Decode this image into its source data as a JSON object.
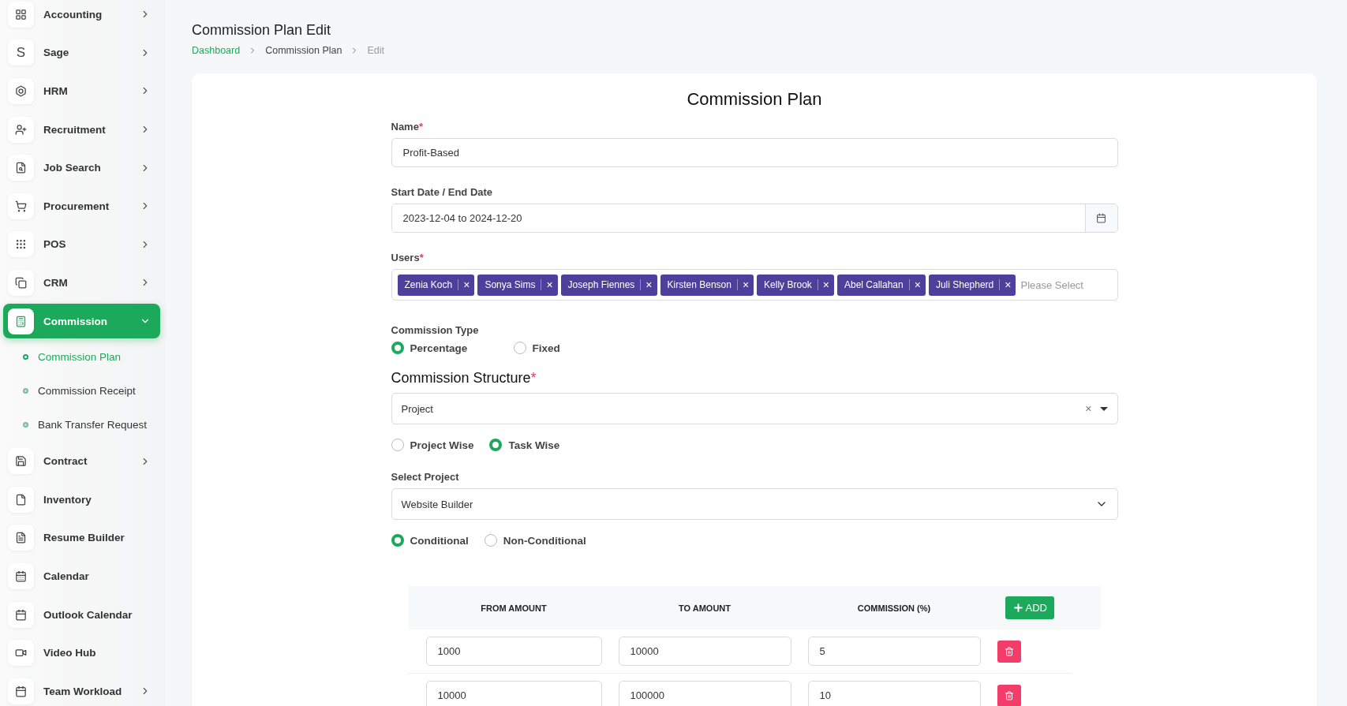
{
  "sidebar": {
    "items": [
      {
        "label": "Accounting",
        "has_arrow": true,
        "expanded": false,
        "selected": false
      },
      {
        "label": "Sage",
        "icon_letter": "S",
        "has_arrow": true,
        "expanded": false,
        "selected": false
      },
      {
        "label": "HRM",
        "has_arrow": true,
        "expanded": false,
        "selected": false
      },
      {
        "label": "Recruitment",
        "has_arrow": true,
        "expanded": false,
        "selected": false
      },
      {
        "label": "Job Search",
        "has_arrow": true,
        "expanded": false,
        "selected": false
      },
      {
        "label": "Procurement",
        "has_arrow": true,
        "expanded": false,
        "selected": false
      },
      {
        "label": "POS",
        "has_arrow": true,
        "expanded": false,
        "selected": false
      },
      {
        "label": "CRM",
        "has_arrow": true,
        "expanded": false,
        "selected": false
      },
      {
        "label": "Commission",
        "has_arrow": true,
        "expanded": true,
        "selected": true,
        "children": [
          {
            "label": "Commission Plan",
            "selected": true
          },
          {
            "label": "Commission Receipt",
            "selected": false
          },
          {
            "label": "Bank Transfer Request",
            "selected": false
          }
        ]
      },
      {
        "label": "Contract",
        "has_arrow": true,
        "expanded": false,
        "selected": false
      },
      {
        "label": "Inventory",
        "has_arrow": false,
        "selected": false
      },
      {
        "label": "Resume Builder",
        "has_arrow": false,
        "selected": false
      },
      {
        "label": "Calendar",
        "has_arrow": false,
        "selected": false
      },
      {
        "label": "Outlook Calendar",
        "has_arrow": false,
        "selected": false
      },
      {
        "label": "Video Hub",
        "has_arrow": false,
        "selected": false
      },
      {
        "label": "Team Workload",
        "has_arrow": true,
        "expanded": false,
        "selected": false
      }
    ]
  },
  "page": {
    "title": "Commission Plan Edit",
    "breadcrumb": [
      "Dashboard",
      "Commission Plan",
      "Edit"
    ]
  },
  "form": {
    "heading": "Commission Plan",
    "name": {
      "label": "Name",
      "required_mark": "*",
      "value": "Profit-Based"
    },
    "dates": {
      "label": "Start Date / End Date",
      "value": "2023-12-04 to 2024-12-20"
    },
    "users": {
      "label": "Users",
      "required_mark": "*",
      "tags": [
        "Zenia Koch",
        "Sonya Sims",
        "Joseph Fiennes",
        "Kirsten Benson",
        "Kelly Brook",
        "Abel Callahan",
        "Juli Shepherd"
      ],
      "remove": "×",
      "placeholder": "Please Select"
    },
    "commission_type": {
      "label": "Commission Type",
      "options": [
        {
          "label": "Percentage",
          "selected": true
        },
        {
          "label": "Fixed",
          "selected": false
        }
      ]
    },
    "structure": {
      "heading": "Commission Structure",
      "required_mark": "*",
      "value": "Project",
      "clear": "×"
    },
    "scope": {
      "options": [
        {
          "label": "Project Wise",
          "selected": false
        },
        {
          "label": "Task Wise",
          "selected": true
        }
      ]
    },
    "project": {
      "label": "Select Project",
      "value": "Website Builder"
    },
    "condition": {
      "options": [
        {
          "label": "Conditional",
          "selected": true
        },
        {
          "label": "Non-Conditional",
          "selected": false
        }
      ]
    },
    "table": {
      "columns": [
        "FROM AMOUNT",
        "TO AMOUNT",
        "COMMISSION (%)"
      ],
      "add_label": "ADD",
      "rows": [
        [
          "1000",
          "10000",
          "5"
        ],
        [
          "10000",
          "100000",
          "10"
        ]
      ]
    }
  }
}
